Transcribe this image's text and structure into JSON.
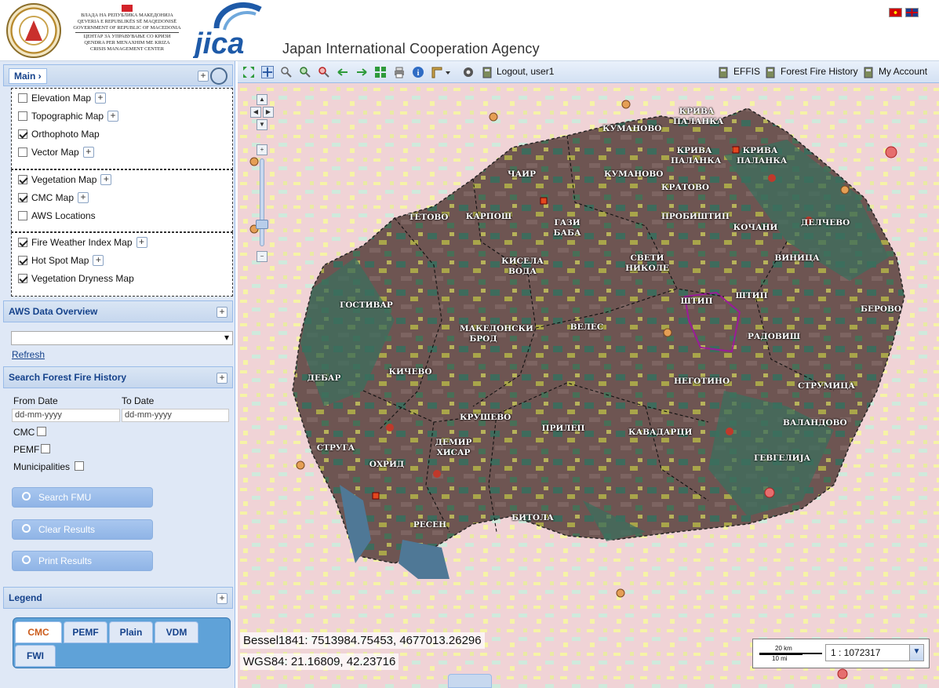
{
  "header": {
    "crisis_lines": [
      "ВЛАДА НА РЕПУБЛИКА МАКЕДОНИЈА",
      "QEVERIA E REPUBLIKËS SË MAQEDONISË",
      "GOVERNMENT OF REPUBLIC OF MACEDONIA",
      "ЦЕНТАР ЗА УПРАВУВАЊЕ СО КРИЗИ",
      "QENDRA PER MENAXHIM ME KRIZA",
      "CRISIS MANAGEMENT CENTER"
    ],
    "jica_name": "Japan International Cooperation Agency",
    "jica_word": "JICA",
    "languages": [
      "mk-flag-icon",
      "gb-flag-icon"
    ]
  },
  "sidebar": {
    "main_tab": "Main ›",
    "layer_groups": [
      [
        {
          "label": "Elevation Map",
          "checked": false,
          "plus": true
        },
        {
          "label": "Topographic Map",
          "checked": false,
          "plus": true
        },
        {
          "label": "Orthophoto Map",
          "checked": true,
          "plus": false
        },
        {
          "label": "Vector Map",
          "checked": false,
          "plus": true
        }
      ],
      [
        {
          "label": "Vegetation Map",
          "checked": true,
          "plus": true
        },
        {
          "label": "CMC Map",
          "checked": true,
          "plus": true
        },
        {
          "label": "AWS Locations",
          "checked": false,
          "plus": false
        }
      ],
      [
        {
          "label": "Fire Weather Index Map",
          "checked": true,
          "plus": true
        },
        {
          "label": "Hot Spot Map",
          "checked": true,
          "plus": true
        },
        {
          "label": "Vegetation Dryness Map",
          "checked": true,
          "plus": false
        }
      ]
    ],
    "aws_title": "AWS Data Overview",
    "refresh": "Refresh",
    "search_title": "Search Forest Fire History",
    "from_label": "From Date",
    "to_label": "To Date",
    "date_placeholder": "dd-mm-yyyy",
    "cmc": "CMC",
    "pemf": "PEMF",
    "municipalities": "Municipalities",
    "btn_search": "Search FMU",
    "btn_clear": "Clear Results",
    "btn_print": "Print Results",
    "legend_title": "Legend",
    "legend_tabs": [
      "CMC",
      "PEMF",
      "Plain",
      "VDM",
      "FWI"
    ]
  },
  "toolbar": {
    "logout": "Logout, user1",
    "effis": "EFFIS",
    "history": "Forest Fire History",
    "account": "My Account"
  },
  "map": {
    "coords_bessel": "Bessel1841: 7513984.75453, 4677013.26296",
    "coords_wgs": "WGS84: 21.16809, 42.23716",
    "scale_km": "20 km",
    "scale_mi": "10 mi",
    "scale_value": "1 : 1072317",
    "municipalities": [
      "КУМАНОВО",
      "КРИВА\nПАЛАНКА",
      "КРИВА\nПАЛАНКА",
      "КРИВА\nПАЛАНКА",
      "ЧАИР",
      "КУМАНОВО",
      "КРАТОВО",
      "ТЕТОВО",
      "КАРПОШ",
      "ГАЗИ\nБАБА",
      "ПРОБИШТИП",
      "КОЧАНИ",
      "ДЕЛЧЕВО",
      "КИСЕЛА\nВОДА",
      "СВЕТИ\nНИКОЛЕ",
      "ВИНИЦА",
      "ШТИП",
      "ШТИП",
      "ГОСТИВАР",
      "БЕРОВО",
      "МАКЕДОНСКИ\nБРОД",
      "ВЕЛЕС",
      "РАДОВИШ",
      "ДЕБАР",
      "КИЧЕВО",
      "НЕГОТИНО",
      "СТРУМИЦА",
      "КРУШЕВО",
      "ПРИЛЕП",
      "КАВАДАРЦИ",
      "ВАЛАНДОВО",
      "СТРУГА",
      "ОХРИД",
      "ДЕМИР\nХИСАР",
      "ГЕВГЕЛИЈА",
      "РЕСЕН",
      "БИТОЛА"
    ]
  }
}
